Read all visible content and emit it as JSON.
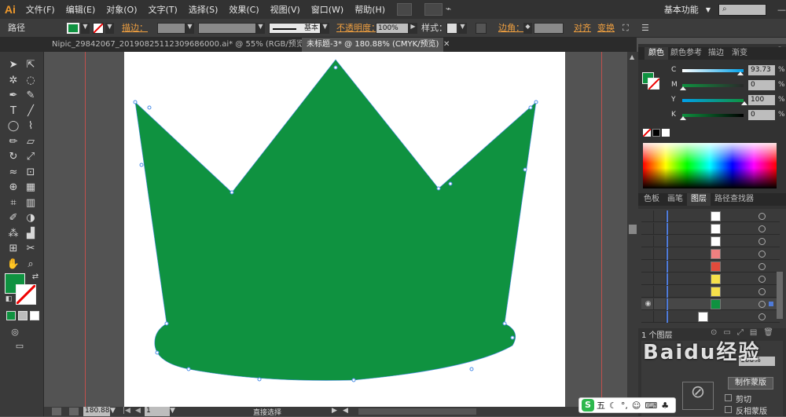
{
  "app": {
    "logo": "Ai",
    "menus": [
      "文件(F)",
      "编辑(E)",
      "对象(O)",
      "文字(T)",
      "选择(S)",
      "效果(C)",
      "视图(V)",
      "窗口(W)",
      "帮助(H)"
    ],
    "workspace": "基本功能"
  },
  "control": {
    "path_label": "路径",
    "stroke_label": "描边：",
    "stroke_style": "基本",
    "opacity_label": "不透明度：",
    "opacity_value": "100%",
    "style_label": "样式：",
    "corner_label": "边角：",
    "align_label": "对齐",
    "transform_label": "变换"
  },
  "tabs": [
    {
      "label": "Nipic_29842067_20190825112309686000.ai* @ 55% (RGB/预览)"
    },
    {
      "label": "未标题-3* @ 180.88% (CMYK/预览)"
    }
  ],
  "status": {
    "zoom": "180.88",
    "page": "1",
    "tool": "直接选择"
  },
  "panel": {
    "tabs": [
      "颜色",
      "颜色参考",
      "描边",
      "渐变"
    ],
    "channels": [
      {
        "name": "C",
        "value": "93.73",
        "pos": 0.94,
        "grad": "linear-gradient(90deg,#fff,#00a0e9)"
      },
      {
        "name": "M",
        "value": "0",
        "pos": 0.0,
        "grad": "linear-gradient(90deg,#0f9240,#2a2a2a)"
      },
      {
        "name": "Y",
        "value": "100",
        "pos": 1.0,
        "grad": "linear-gradient(90deg,#00a0e9,#0f9240)"
      },
      {
        "name": "K",
        "value": "0",
        "pos": 0.0,
        "grad": "linear-gradient(90deg,#0f9240,#000)"
      }
    ],
    "layer_tabs": [
      "色板",
      "画笔",
      "图层",
      "路径查找器"
    ],
    "layers_footer": "1 个图层",
    "pct": "%"
  },
  "colors": {
    "fill": "#0f9240",
    "accent": "#f09a2c"
  },
  "watermark": "Baidu经验",
  "overlay": {
    "mask_btn": "制作蒙版",
    "clip": "剪切",
    "invert": "反相蒙版",
    "ime": "五"
  }
}
